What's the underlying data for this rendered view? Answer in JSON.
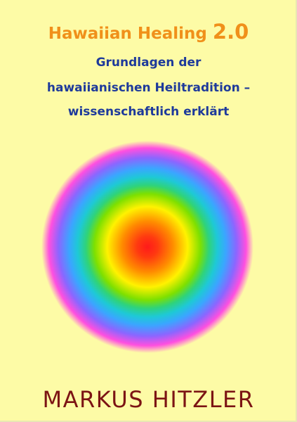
{
  "cover": {
    "title": "Hawaiian Healing",
    "title_version": "2.0",
    "subtitle_lines": [
      "Grundlagen der",
      "hawaiianischen Heiltradition –",
      "wissenschaftlich erklärt"
    ],
    "author": "MARKUS HITZLER"
  },
  "colors": {
    "background": "#fdfba6",
    "title": "#f0901a",
    "subtitle": "#1e3a9b",
    "author": "#7c1414"
  }
}
